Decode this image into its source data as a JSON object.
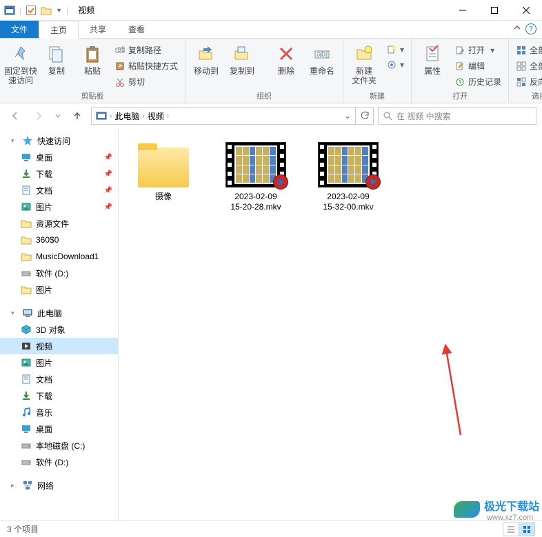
{
  "window": {
    "title": "视频"
  },
  "tabs": {
    "file": "文件",
    "home": "主页",
    "share": "共享",
    "view": "查看"
  },
  "ribbon": {
    "pin": "固定到快\n速访问",
    "copy": "复制",
    "paste": "粘贴",
    "copypath": "复制路径",
    "pasteshortcut": "粘贴快捷方式",
    "cut": "剪切",
    "group_clipboard": "剪贴板",
    "moveto": "移动到",
    "copyto": "复制到",
    "delete": "删除",
    "rename": "重命名",
    "group_organize": "组织",
    "newfolder": "新建\n文件夹",
    "group_new": "新建",
    "properties": "属性",
    "open": "打开",
    "edit": "编辑",
    "history": "历史记录",
    "group_open": "打开",
    "selectall": "全部选择",
    "selectnone": "全部取消",
    "selectinvert": "反向选择",
    "group_select": "选择"
  },
  "breadcrumb": {
    "pc": "此电脑",
    "videos": "视频"
  },
  "search": {
    "placeholder": "在 视频 中搜索"
  },
  "sidebar": {
    "quickaccess": "快速访问",
    "items_qa": [
      {
        "label": "桌面",
        "pin": true,
        "icon": "desktop"
      },
      {
        "label": "下载",
        "pin": true,
        "icon": "download"
      },
      {
        "label": "文档",
        "pin": true,
        "icon": "document"
      },
      {
        "label": "图片",
        "pin": true,
        "icon": "picture"
      },
      {
        "label": "资源文件",
        "pin": false,
        "icon": "folder"
      },
      {
        "label": "360$0",
        "pin": false,
        "icon": "folder"
      },
      {
        "label": "MusicDownload1",
        "pin": false,
        "icon": "folder"
      },
      {
        "label": "软件 (D:)",
        "pin": false,
        "icon": "drive"
      },
      {
        "label": "图片",
        "pin": false,
        "icon": "folder"
      }
    ],
    "thispc": "此电脑",
    "items_pc": [
      {
        "label": "3D 对象",
        "icon": "3d"
      },
      {
        "label": "视频",
        "icon": "video",
        "selected": true
      },
      {
        "label": "图片",
        "icon": "picture"
      },
      {
        "label": "文档",
        "icon": "document"
      },
      {
        "label": "下载",
        "icon": "download"
      },
      {
        "label": "音乐",
        "icon": "music"
      },
      {
        "label": "桌面",
        "icon": "desktop"
      },
      {
        "label": "本地磁盘 (C:)",
        "icon": "drive"
      },
      {
        "label": "软件 (D:)",
        "icon": "drive"
      }
    ],
    "network": "网络"
  },
  "files": [
    {
      "name": "摄像",
      "type": "folder"
    },
    {
      "name": "2023-02-09\n15-20-28.mkv",
      "type": "video"
    },
    {
      "name": "2023-02-09\n15-32-00.mkv",
      "type": "video"
    }
  ],
  "status": {
    "items": "3 个项目"
  },
  "watermark": {
    "name": "极光下载站",
    "url": "www.xz7.com"
  }
}
